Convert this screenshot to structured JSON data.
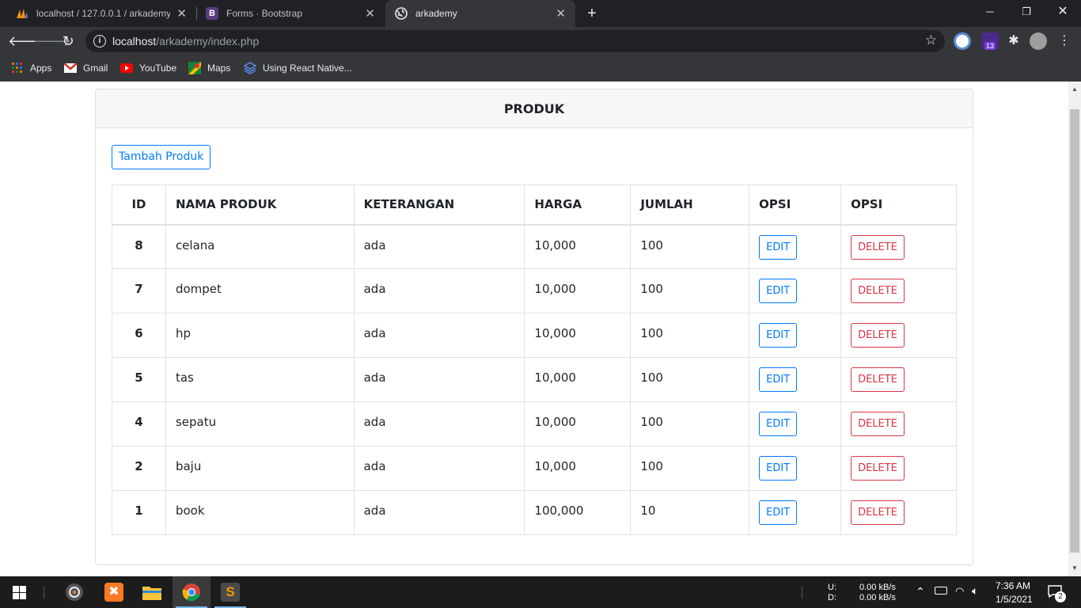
{
  "browser": {
    "tabs": [
      {
        "title": "localhost / 127.0.0.1 / arkademy /",
        "icon": "phpmyadmin-icon",
        "active": false
      },
      {
        "title": "Forms · Bootstrap",
        "icon": "bootstrap-icon",
        "active": false
      },
      {
        "title": "arkademy",
        "icon": "globe-icon",
        "active": true
      }
    ],
    "address": {
      "host": "localhost",
      "path": "/arkademy/index.php"
    },
    "extension_badge": "13",
    "bookmarks": [
      {
        "label": "Apps",
        "icon": "apps-grid-icon"
      },
      {
        "label": "Gmail",
        "icon": "gmail-icon"
      },
      {
        "label": "YouTube",
        "icon": "youtube-icon"
      },
      {
        "label": "Maps",
        "icon": "maps-icon"
      },
      {
        "label": "Using React Native...",
        "icon": "layers-icon"
      }
    ]
  },
  "page": {
    "card_title": "PRODUK",
    "add_button": "Tambah Produk",
    "table": {
      "columns": [
        "ID",
        "NAMA PRODUK",
        "KETERANGAN",
        "HARGA",
        "JUMLAH",
        "OPSI",
        "OPSI"
      ],
      "edit_label": "EDIT",
      "delete_label": "DELETE",
      "rows": [
        {
          "id": "8",
          "nama": "celana",
          "keterangan": "ada",
          "harga": "10,000",
          "jumlah": "100"
        },
        {
          "id": "7",
          "nama": "dompet",
          "keterangan": "ada",
          "harga": "10,000",
          "jumlah": "100"
        },
        {
          "id": "6",
          "nama": "hp",
          "keterangan": "ada",
          "harga": "10,000",
          "jumlah": "100"
        },
        {
          "id": "5",
          "nama": "tas",
          "keterangan": "ada",
          "harga": "10,000",
          "jumlah": "100"
        },
        {
          "id": "4",
          "nama": "sepatu",
          "keterangan": "ada",
          "harga": "10,000",
          "jumlah": "100"
        },
        {
          "id": "2",
          "nama": "baju",
          "keterangan": "ada",
          "harga": "10,000",
          "jumlah": "100"
        },
        {
          "id": "1",
          "nama": "book",
          "keterangan": "ada",
          "harga": "100,000",
          "jumlah": "10"
        }
      ]
    }
  },
  "taskbar": {
    "net_up_label": "U:",
    "net_down_label": "D:",
    "net_up": "0.00 kB/s",
    "net_down": "0.00 kB/s",
    "time": "7:36 AM",
    "date": "1/5/2021",
    "notifications": "2"
  },
  "colors": {
    "primary": "#007bff",
    "danger": "#dc3545",
    "chrome_dark": "#202124",
    "chrome_mid": "#35363a"
  }
}
